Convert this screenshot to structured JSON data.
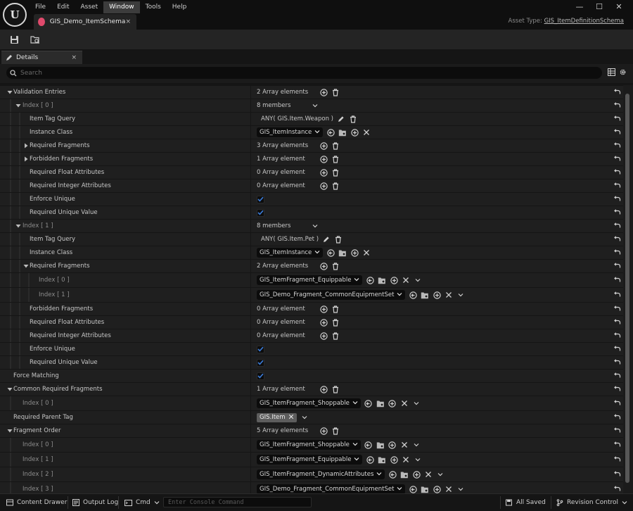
{
  "menu": [
    "File",
    "Edit",
    "Asset",
    "Window",
    "Tools",
    "Help"
  ],
  "menu_active_index": 3,
  "document_tab": {
    "title": "GIS_Demo_ItemSchema",
    "close": "×"
  },
  "asset_type": {
    "label": "Asset Type:",
    "value": "GIS_ItemDefinitionSchema"
  },
  "details_tab": {
    "title": "Details",
    "close": "×"
  },
  "search": {
    "placeholder": "Search"
  },
  "accent_color": "#3b7bd6",
  "rows": [
    {
      "name": "row-validation-entries",
      "label": "Validation Entries",
      "level": 0,
      "expander": "open",
      "value": {
        "type": "array",
        "text": "2 Array elements"
      }
    },
    {
      "name": "row-index-0",
      "label": "Index [ 0 ]",
      "level": 1,
      "dim": true,
      "expander": "open",
      "value": {
        "type": "members",
        "text": "8 members"
      }
    },
    {
      "name": "row-item-tag-query",
      "label": "Item Tag Query",
      "level": 2,
      "value": {
        "type": "query",
        "text": "ANY( GIS.Item.Weapon )"
      }
    },
    {
      "name": "row-instance-class",
      "label": "Instance Class",
      "level": 2,
      "value": {
        "type": "class",
        "text": "GIS_ItemInstance"
      }
    },
    {
      "name": "row-required-fragments",
      "label": "Required Fragments",
      "level": 2,
      "expander": "closed",
      "value": {
        "type": "array",
        "text": "3 Array elements"
      }
    },
    {
      "name": "row-forbidden-fragments",
      "label": "Forbidden Fragments",
      "level": 2,
      "expander": "closed",
      "value": {
        "type": "array",
        "text": "1 Array element"
      }
    },
    {
      "name": "row-required-float-attributes",
      "label": "Required Float Attributes",
      "level": 2,
      "value": {
        "type": "array",
        "text": "0 Array element"
      }
    },
    {
      "name": "row-required-integer-attributes",
      "label": "Required Integer Attributes",
      "level": 2,
      "value": {
        "type": "array",
        "text": "0 Array element"
      }
    },
    {
      "name": "row-enforce-unique",
      "label": "Enforce Unique",
      "level": 2,
      "value": {
        "type": "check",
        "checked": true
      }
    },
    {
      "name": "row-required-unique-value",
      "label": "Required Unique Value",
      "level": 2,
      "value": {
        "type": "check",
        "checked": true
      }
    },
    {
      "name": "row-index-1",
      "label": "Index [ 1 ]",
      "level": 1,
      "dim": true,
      "expander": "open",
      "value": {
        "type": "members",
        "text": "8 members"
      }
    },
    {
      "name": "row-item-tag-query",
      "label": "Item Tag Query",
      "level": 2,
      "value": {
        "type": "query",
        "text": "ANY( GIS.Item.Pet )"
      }
    },
    {
      "name": "row-instance-class",
      "label": "Instance Class",
      "level": 2,
      "value": {
        "type": "class",
        "text": "GIS_ItemInstance"
      }
    },
    {
      "name": "row-required-fragments",
      "label": "Required Fragments",
      "level": 2,
      "expander": "open",
      "value": {
        "type": "array",
        "text": "2 Array elements"
      }
    },
    {
      "name": "row-fragment-index-0",
      "label": "Index [ 0 ]",
      "level": 3,
      "dim": true,
      "tall": true,
      "value": {
        "type": "fragment",
        "text": "GIS_ItemFragment_Equippable"
      }
    },
    {
      "name": "row-fragment-index-1",
      "label": "Index [ 1 ]",
      "level": 3,
      "dim": true,
      "tall": true,
      "value": {
        "type": "fragment",
        "text": "GIS_Demo_Fragment_CommonEquipmentSet"
      }
    },
    {
      "name": "row-forbidden-fragments",
      "label": "Forbidden Fragments",
      "level": 2,
      "value": {
        "type": "array",
        "text": "0 Array element",
        "single": true
      }
    },
    {
      "name": "row-required-float-attributes",
      "label": "Required Float Attributes",
      "level": 2,
      "value": {
        "type": "array",
        "text": "0 Array element",
        "single": true
      }
    },
    {
      "name": "row-required-integer-attributes",
      "label": "Required Integer Attributes",
      "level": 2,
      "value": {
        "type": "array",
        "text": "0 Array element",
        "single": true
      }
    },
    {
      "name": "row-enforce-unique",
      "label": "Enforce Unique",
      "level": 2,
      "value": {
        "type": "check",
        "checked": true
      }
    },
    {
      "name": "row-required-unique-value",
      "label": "Required Unique Value",
      "level": 2,
      "value": {
        "type": "check",
        "checked": true
      }
    },
    {
      "name": "row-force-matching",
      "label": "Force Matching",
      "level": 0.5,
      "value": {
        "type": "check",
        "checked": true
      }
    },
    {
      "name": "row-common-required-fragments",
      "label": "Common Required Fragments",
      "level": 0,
      "expander": "open",
      "value": {
        "type": "array",
        "text": "1 Array element"
      }
    },
    {
      "name": "row-common-index-0",
      "label": "Index [ 0 ]",
      "level": 1,
      "dim": true,
      "tall": true,
      "value": {
        "type": "fragment",
        "text": "GIS_ItemFragment_Shoppable"
      }
    },
    {
      "name": "row-required-parent-tag",
      "label": "Required Parent Tag",
      "level": 0.5,
      "value": {
        "type": "tag",
        "text": "GIS.Item"
      }
    },
    {
      "name": "row-fragment-order",
      "label": "Fragment Order",
      "level": 0,
      "expander": "open",
      "value": {
        "type": "array",
        "text": "5 Array elements"
      }
    },
    {
      "name": "row-order-index-0",
      "label": "Index [ 0 ]",
      "level": 1,
      "dim": true,
      "tall": true,
      "value": {
        "type": "fragment",
        "text": "GIS_ItemFragment_Shoppable"
      }
    },
    {
      "name": "row-order-index-1",
      "label": "Index [ 1 ]",
      "level": 1,
      "dim": true,
      "tall": true,
      "value": {
        "type": "fragment",
        "text": "GIS_ItemFragment_Equippable"
      }
    },
    {
      "name": "row-order-index-2",
      "label": "Index [ 2 ]",
      "level": 1,
      "dim": true,
      "tall": true,
      "value": {
        "type": "fragment",
        "text": "GIS_ItemFragment_DynamicAttributes"
      }
    },
    {
      "name": "row-order-index-3",
      "label": "Index [ 3 ]",
      "level": 1,
      "dim": true,
      "tall": true,
      "value": {
        "type": "fragment",
        "text": "GIS_Demo_Fragment_CommonEquipmentSet"
      }
    }
  ],
  "statusbar": {
    "content_drawer": "Content Drawer",
    "output_log": "Output Log",
    "cmd": "Cmd",
    "console_placeholder": "Enter Console Command",
    "all_saved": "All Saved",
    "revision_control": "Revision Control"
  }
}
